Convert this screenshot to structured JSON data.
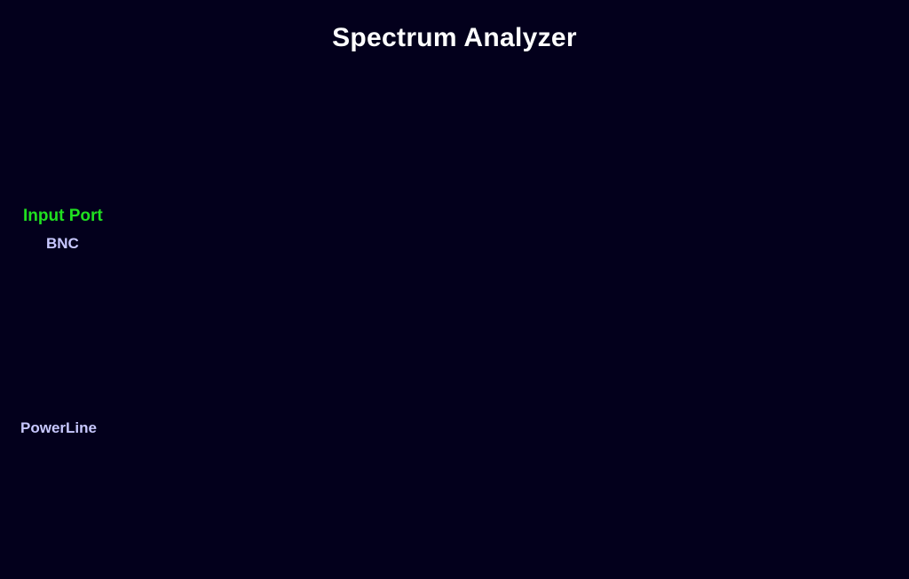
{
  "app": {
    "title": "Spectrum Analyzer"
  },
  "input_port": {
    "label": "Input Port",
    "options": [
      {
        "label": "BNC"
      },
      {
        "label": "PowerLine"
      }
    ]
  },
  "colors": {
    "background": "#03001c",
    "title": "#ffffff",
    "section_label": "#20e020",
    "option_text": "#c8c8ff"
  }
}
